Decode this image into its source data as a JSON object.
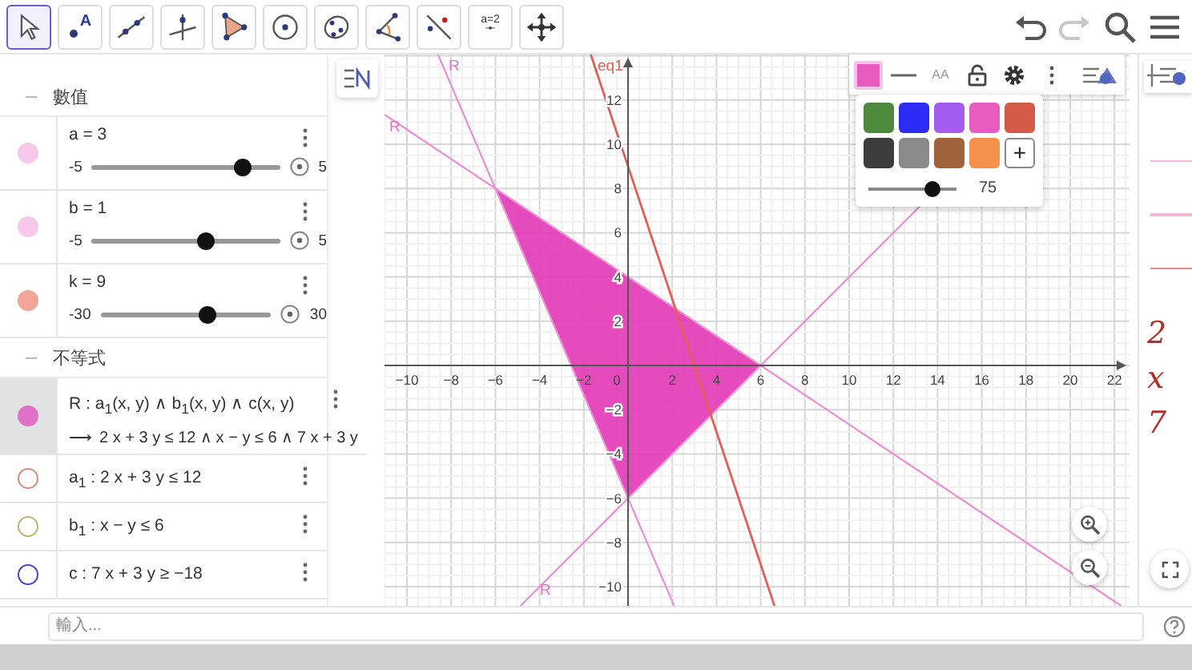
{
  "toolbar": {
    "tools": [
      {
        "kind": "move",
        "selected": true
      },
      {
        "kind": "point",
        "label": "A",
        "selected": false
      },
      {
        "kind": "line",
        "selected": false
      },
      {
        "kind": "perpendicular",
        "selected": false
      },
      {
        "kind": "polygon",
        "selected": false
      },
      {
        "kind": "circle",
        "selected": false
      },
      {
        "kind": "conic",
        "selected": false
      },
      {
        "kind": "angle",
        "selected": false
      },
      {
        "kind": "reflect",
        "selected": false
      },
      {
        "kind": "slider",
        "label": "a=2",
        "selected": false
      },
      {
        "kind": "pan",
        "selected": false
      }
    ],
    "actions": [
      {
        "kind": "undo",
        "disabled": false
      },
      {
        "kind": "redo",
        "disabled": true
      },
      {
        "kind": "search",
        "disabled": false
      },
      {
        "kind": "menu",
        "disabled": false
      }
    ]
  },
  "algebra": {
    "groups": [
      {
        "title": "數值",
        "expanded": true,
        "items": [
          {
            "kind": "slider",
            "label": "a = 3",
            "min": "-5",
            "max": "5",
            "level": 0.8,
            "color": "#f7c8ea",
            "visible": true,
            "selected": false
          },
          {
            "kind": "slider",
            "label": "b = 1",
            "min": "-5",
            "max": "5",
            "level": 0.61,
            "color": "#f7c8ea",
            "visible": true,
            "selected": false
          },
          {
            "kind": "slider",
            "label": "k = 9",
            "min": "-30",
            "max": "30",
            "level": 0.63,
            "color": "#f4a59a",
            "visible": true,
            "selected": false
          }
        ]
      },
      {
        "title": "不等式",
        "expanded": true,
        "items": [
          {
            "kind": "definition",
            "label": "R : a$_{1}$(x, y) ∧ b$_{1}$(x, y) ∧ c(x, y)",
            "arrow": "⟶",
            "value": "2 x + 3 y ≤ 12 ∧ x − y ≤ 6 ∧ 7 x + 3 y",
            "color": "#e070c8",
            "visible": true,
            "selected": true
          },
          {
            "kind": "plain",
            "label": "a$_{1}$ : 2 x + 3 y ≤ 12",
            "color": "#d98c80",
            "visible": false,
            "selected": false
          },
          {
            "kind": "plain",
            "label": "b$_{1}$ : x − y ≤ 6",
            "color": "#b9b774",
            "visible": false,
            "selected": false
          },
          {
            "kind": "plain",
            "label": "c : 7 x + 3 y ≥ −18",
            "color": "#4b44c8",
            "visible": false,
            "selected": false
          }
        ]
      }
    ]
  },
  "graph": {
    "x_tick_labels": [
      "−10",
      "−8",
      "−6",
      "−4",
      "−2",
      "0",
      "2",
      "4",
      "6",
      "8",
      "10",
      "12",
      "14",
      "16",
      "18",
      "20",
      "22"
    ],
    "y_tick_labels": [
      "12",
      "10",
      "8",
      "6",
      "4",
      "2",
      "−2",
      "−4",
      "−6",
      "−8",
      "−10"
    ],
    "curve_labels": [
      "R",
      "R",
      "R",
      "eq1"
    ]
  },
  "style_bar": {
    "color": "#e85bbf",
    "label_style": "AA",
    "palette": [
      {
        "kind": "color",
        "color": "#4e8a3c"
      },
      {
        "kind": "color",
        "color": "#2b2bf5"
      },
      {
        "kind": "color",
        "color": "#a35cf0"
      },
      {
        "kind": "color",
        "color": "#e85bbf"
      },
      {
        "kind": "color",
        "color": "#d35b48"
      },
      {
        "kind": "color",
        "color": "#3c3c3c"
      },
      {
        "kind": "color",
        "color": "#8a8a8a"
      },
      {
        "kind": "color",
        "color": "#a0643c"
      },
      {
        "kind": "color",
        "color": "#f5914a"
      },
      {
        "kind": "add",
        "label": "+"
      }
    ],
    "opacity": {
      "level": 0.72,
      "reading": "75"
    }
  },
  "side_panel": {
    "texts": [
      "2",
      "x",
      "7"
    ]
  },
  "input": {
    "placeholder": "輸入..."
  }
}
